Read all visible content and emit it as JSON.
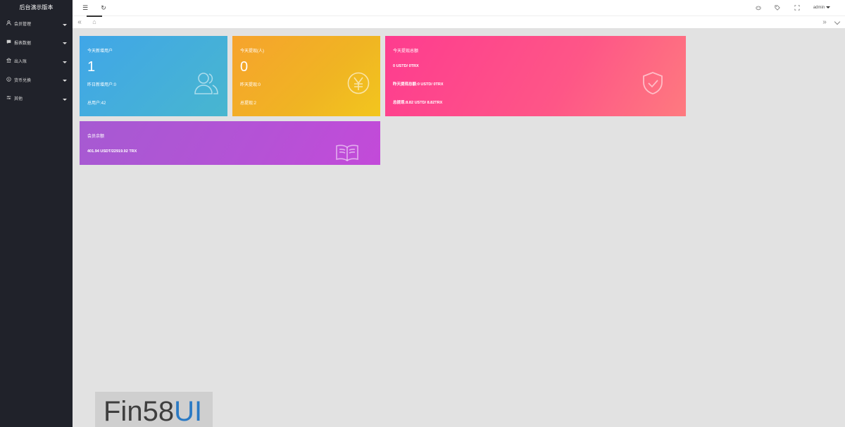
{
  "sidebar": {
    "title": "后台演示版本",
    "items": [
      {
        "label": "会员管理",
        "icon": "user-icon"
      },
      {
        "label": "报表数据",
        "icon": "chat-icon"
      },
      {
        "label": "出入账",
        "icon": "bank-icon"
      },
      {
        "label": "货币兑换",
        "icon": "dollar-icon"
      },
      {
        "label": "其他",
        "icon": "settings-icon"
      }
    ]
  },
  "header": {
    "menu_icon": "☰",
    "refresh_icon": "↻",
    "user": "admin"
  },
  "tabs": {
    "prev": "«",
    "home_icon": "⌂",
    "next": "»"
  },
  "cards": {
    "new_users": {
      "title": "今天新增用户",
      "value": "1",
      "line1": "昨日新增用户:0",
      "line2": "总用户:42"
    },
    "withdraw": {
      "title": "今天提现(人)",
      "value": "0",
      "line1": "昨天提现:0",
      "line2": "总提现:2"
    },
    "withdraw_total": {
      "title": "今天提现总额",
      "line1": "0 USTD/ 0TRX",
      "line2": "昨天提现总额:0 USTD/ 0TRX",
      "line3": "总提现:8.82 USTD/ 8.82TRX"
    },
    "balance": {
      "title": "会员余额",
      "line1": "401.94 USDT/22919.92 TRX"
    }
  },
  "watermark": {
    "text1": "Fin58",
    "text2": "UI"
  },
  "colors": {
    "sidebar_bg": "#20222a",
    "card_blue": "#40a6e8",
    "card_orange": "#f6a32d",
    "card_pink": "#fe3c8f",
    "card_purple": "#a65ad2"
  }
}
